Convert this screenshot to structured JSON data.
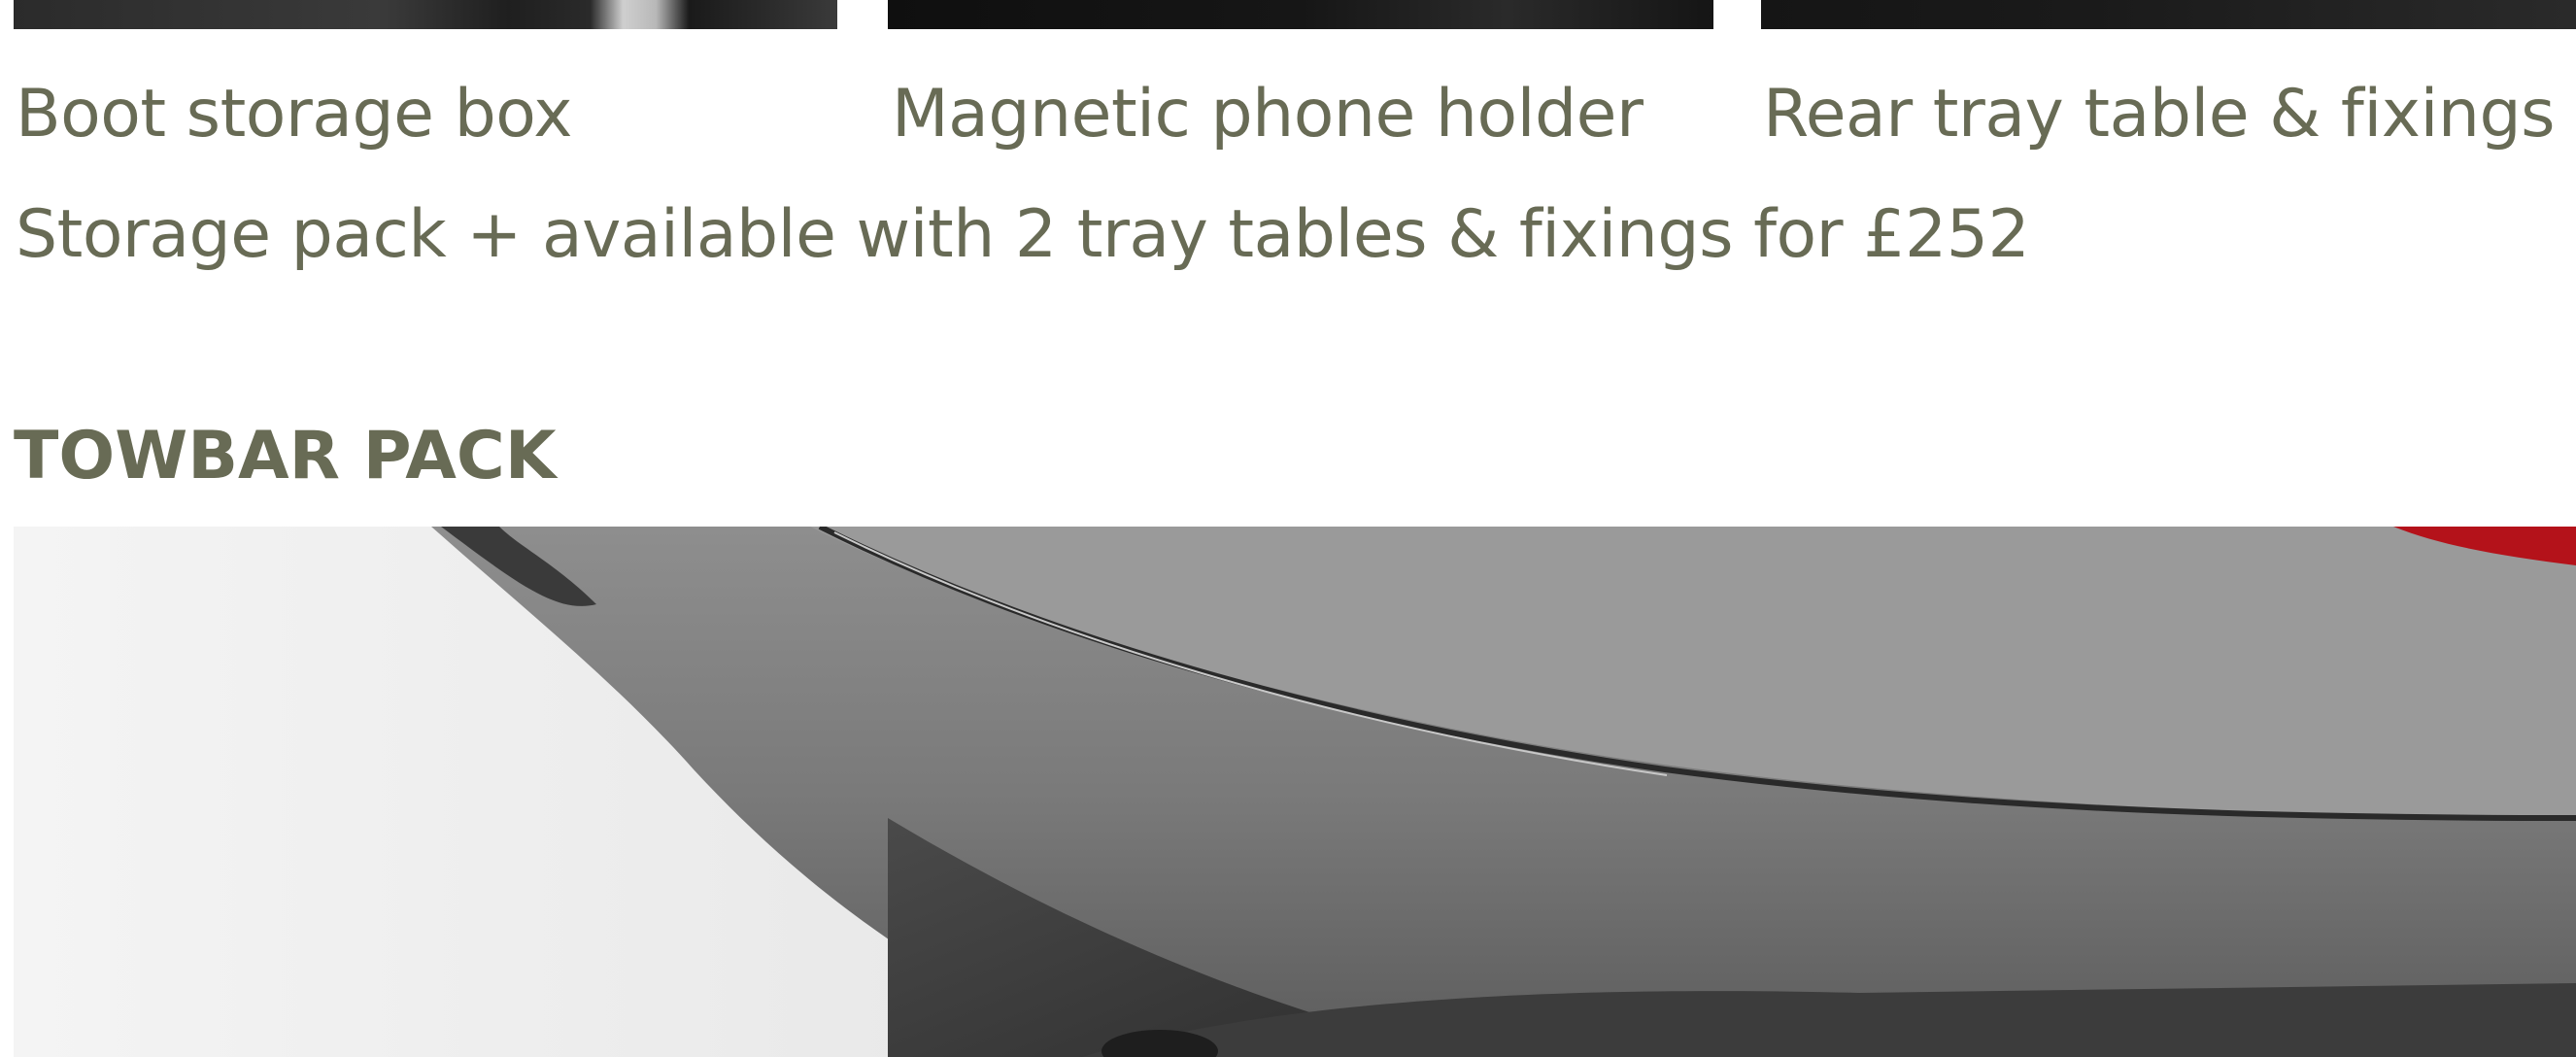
{
  "storage_pack": {
    "items": [
      {
        "label": "Boot storage box"
      },
      {
        "label": "Magnetic phone holder"
      },
      {
        "label": "Rear tray table & fixings"
      }
    ],
    "note": "Storage pack + available with 2 tray tables & fixings for £252"
  },
  "towbar_pack": {
    "heading": "TOWBAR PACK"
  },
  "colors": {
    "text": "#686b55",
    "background": "#ffffff"
  }
}
